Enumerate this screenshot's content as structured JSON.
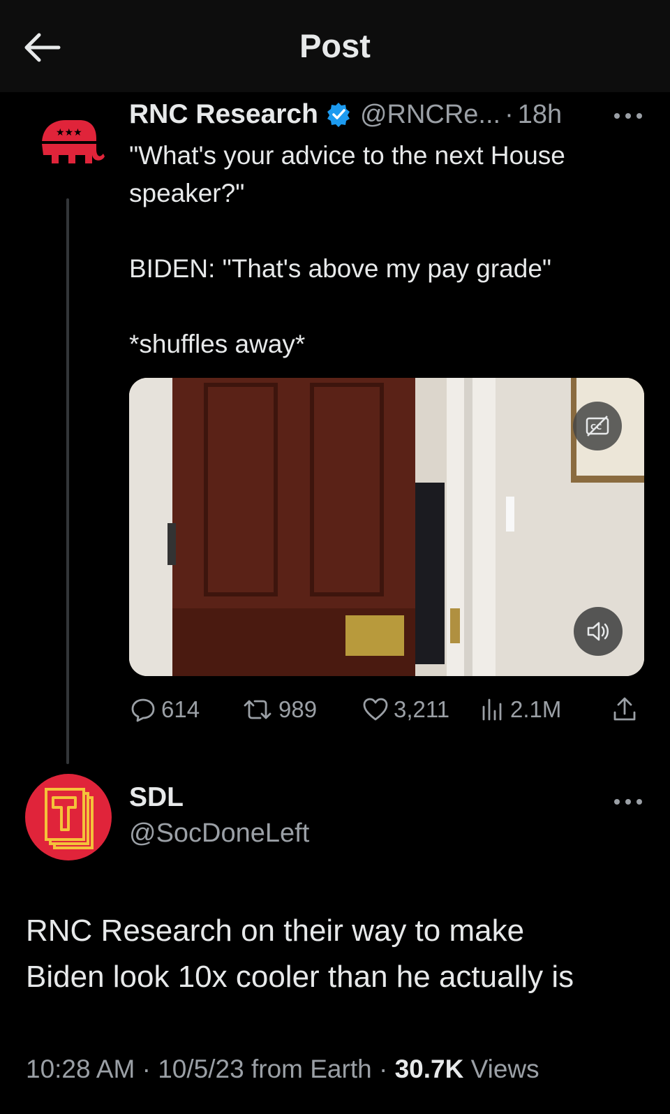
{
  "header": {
    "title": "Post"
  },
  "post": {
    "author_name": "RNC Research",
    "handle": "@RNCRe...",
    "separator": "·",
    "time": "18h",
    "text_lines": [
      "\"What's your advice to the next House speaker?\"",
      "BIDEN: \"That's above my pay grade\"",
      "*shuffles away*"
    ],
    "stats": {
      "replies": "614",
      "reposts": "989",
      "likes": "3,211",
      "views": "2.1M"
    }
  },
  "reply": {
    "author_name": "SDL",
    "handle": "@SocDoneLeft",
    "text_lines": [
      "RNC Research on their way to make",
      "Biden look 10x cooler than he actually is"
    ],
    "timestamp": "10:28 AM",
    "date": "10/5/23",
    "source": "from Earth",
    "view_count": "30.7K",
    "views_label": "Views",
    "sep": "·"
  },
  "colors": {
    "background": "#000000",
    "text": "#e7e9ea",
    "secondary": "#9ba0a6",
    "verified": "#1d9bf0",
    "rnc_red": "#e0243a"
  }
}
